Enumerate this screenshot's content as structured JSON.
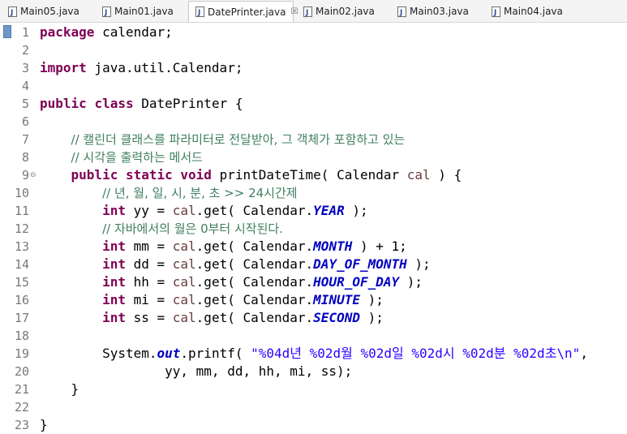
{
  "tabs": [
    {
      "label": "Main05.java",
      "active": false
    },
    {
      "label": "Main01.java",
      "active": false
    },
    {
      "label": "DatePrinter.java",
      "active": true
    },
    {
      "label": "Main02.java",
      "active": false
    },
    {
      "label": "Main03.java",
      "active": false
    },
    {
      "label": "Main04.java",
      "active": false
    }
  ],
  "close_glyph": "☒",
  "fold_glyph": "⊖",
  "lines": [
    {
      "n": "1",
      "t": [
        [
          "kw",
          "package"
        ],
        [
          "pl",
          " calendar;"
        ]
      ]
    },
    {
      "n": "2",
      "t": []
    },
    {
      "n": "3",
      "t": [
        [
          "kw",
          "import"
        ],
        [
          "pl",
          " java.util.Calendar;"
        ]
      ]
    },
    {
      "n": "4",
      "t": []
    },
    {
      "n": "5",
      "t": [
        [
          "kw",
          "public"
        ],
        [
          "pl",
          " "
        ],
        [
          "kw",
          "class"
        ],
        [
          "pl",
          " DatePrinter {"
        ]
      ]
    },
    {
      "n": "6",
      "t": []
    },
    {
      "n": "7",
      "t": [
        [
          "pl",
          "    "
        ],
        [
          "cm",
          "// 캘린더 클래스를 파라미터로 전달받아, 그 객체가 포함하고 있는"
        ]
      ]
    },
    {
      "n": "8",
      "t": [
        [
          "pl",
          "    "
        ],
        [
          "cm",
          "// 시각을 출력하는 메서드"
        ]
      ]
    },
    {
      "n": "9",
      "fold": true,
      "t": [
        [
          "pl",
          "    "
        ],
        [
          "kw",
          "public"
        ],
        [
          "pl",
          " "
        ],
        [
          "kw",
          "static"
        ],
        [
          "pl",
          " "
        ],
        [
          "kw",
          "void"
        ],
        [
          "pl",
          " printDateTime( Calendar "
        ],
        [
          "pm",
          "cal"
        ],
        [
          "pl",
          " ) {"
        ]
      ]
    },
    {
      "n": "10",
      "t": [
        [
          "pl",
          "        "
        ],
        [
          "cm",
          "// 년, 월, 일, 시, 분, 초 >> 24시간제"
        ]
      ]
    },
    {
      "n": "11",
      "t": [
        [
          "pl",
          "        "
        ],
        [
          "kw",
          "int"
        ],
        [
          "pl",
          " yy = "
        ],
        [
          "pm",
          "cal"
        ],
        [
          "pl",
          ".get( Calendar."
        ],
        [
          "fd",
          "YEAR"
        ],
        [
          "pl",
          " );"
        ]
      ]
    },
    {
      "n": "12",
      "t": [
        [
          "pl",
          "        "
        ],
        [
          "cm",
          "// 자바에서의 월은 0부터 시작된다."
        ]
      ]
    },
    {
      "n": "13",
      "t": [
        [
          "pl",
          "        "
        ],
        [
          "kw",
          "int"
        ],
        [
          "pl",
          " mm = "
        ],
        [
          "pm",
          "cal"
        ],
        [
          "pl",
          ".get( Calendar."
        ],
        [
          "fd",
          "MONTH"
        ],
        [
          "pl",
          " ) + 1;"
        ]
      ]
    },
    {
      "n": "14",
      "t": [
        [
          "pl",
          "        "
        ],
        [
          "kw",
          "int"
        ],
        [
          "pl",
          " dd = "
        ],
        [
          "pm",
          "cal"
        ],
        [
          "pl",
          ".get( Calendar."
        ],
        [
          "fd",
          "DAY_OF_MONTH"
        ],
        [
          "pl",
          " );"
        ]
      ]
    },
    {
      "n": "15",
      "t": [
        [
          "pl",
          "        "
        ],
        [
          "kw",
          "int"
        ],
        [
          "pl",
          " hh = "
        ],
        [
          "pm",
          "cal"
        ],
        [
          "pl",
          ".get( Calendar."
        ],
        [
          "fd",
          "HOUR_OF_DAY"
        ],
        [
          "pl",
          " );"
        ]
      ]
    },
    {
      "n": "16",
      "t": [
        [
          "pl",
          "        "
        ],
        [
          "kw",
          "int"
        ],
        [
          "pl",
          " mi = "
        ],
        [
          "pm",
          "cal"
        ],
        [
          "pl",
          ".get( Calendar."
        ],
        [
          "fd",
          "MINUTE"
        ],
        [
          "pl",
          " );"
        ]
      ]
    },
    {
      "n": "17",
      "t": [
        [
          "pl",
          "        "
        ],
        [
          "kw",
          "int"
        ],
        [
          "pl",
          " ss = "
        ],
        [
          "pm",
          "cal"
        ],
        [
          "pl",
          ".get( Calendar."
        ],
        [
          "fd",
          "SECOND"
        ],
        [
          "pl",
          " );"
        ]
      ]
    },
    {
      "n": "18",
      "t": []
    },
    {
      "n": "19",
      "t": [
        [
          "pl",
          "        System."
        ],
        [
          "of",
          "out"
        ],
        [
          "pl",
          ".printf( "
        ],
        [
          "st",
          "\"%04d년 %02d월 %02d일 %02d시 %02d분 %02d초\\n\""
        ],
        [
          "pl",
          ","
        ]
      ]
    },
    {
      "n": "20",
      "t": [
        [
          "pl",
          "                yy, mm, dd, hh, mi, ss);"
        ]
      ]
    },
    {
      "n": "21",
      "t": [
        [
          "pl",
          "    }"
        ]
      ]
    },
    {
      "n": "22",
      "t": []
    },
    {
      "n": "23",
      "t": [
        [
          "pl",
          "}"
        ]
      ]
    }
  ],
  "colors": {
    "keyword": "#7f0055",
    "comment": "#3f7f5f",
    "string": "#2a00ff",
    "static_field": "#0000c0",
    "parameter": "#6a3e3e",
    "line_number": "#787878"
  }
}
